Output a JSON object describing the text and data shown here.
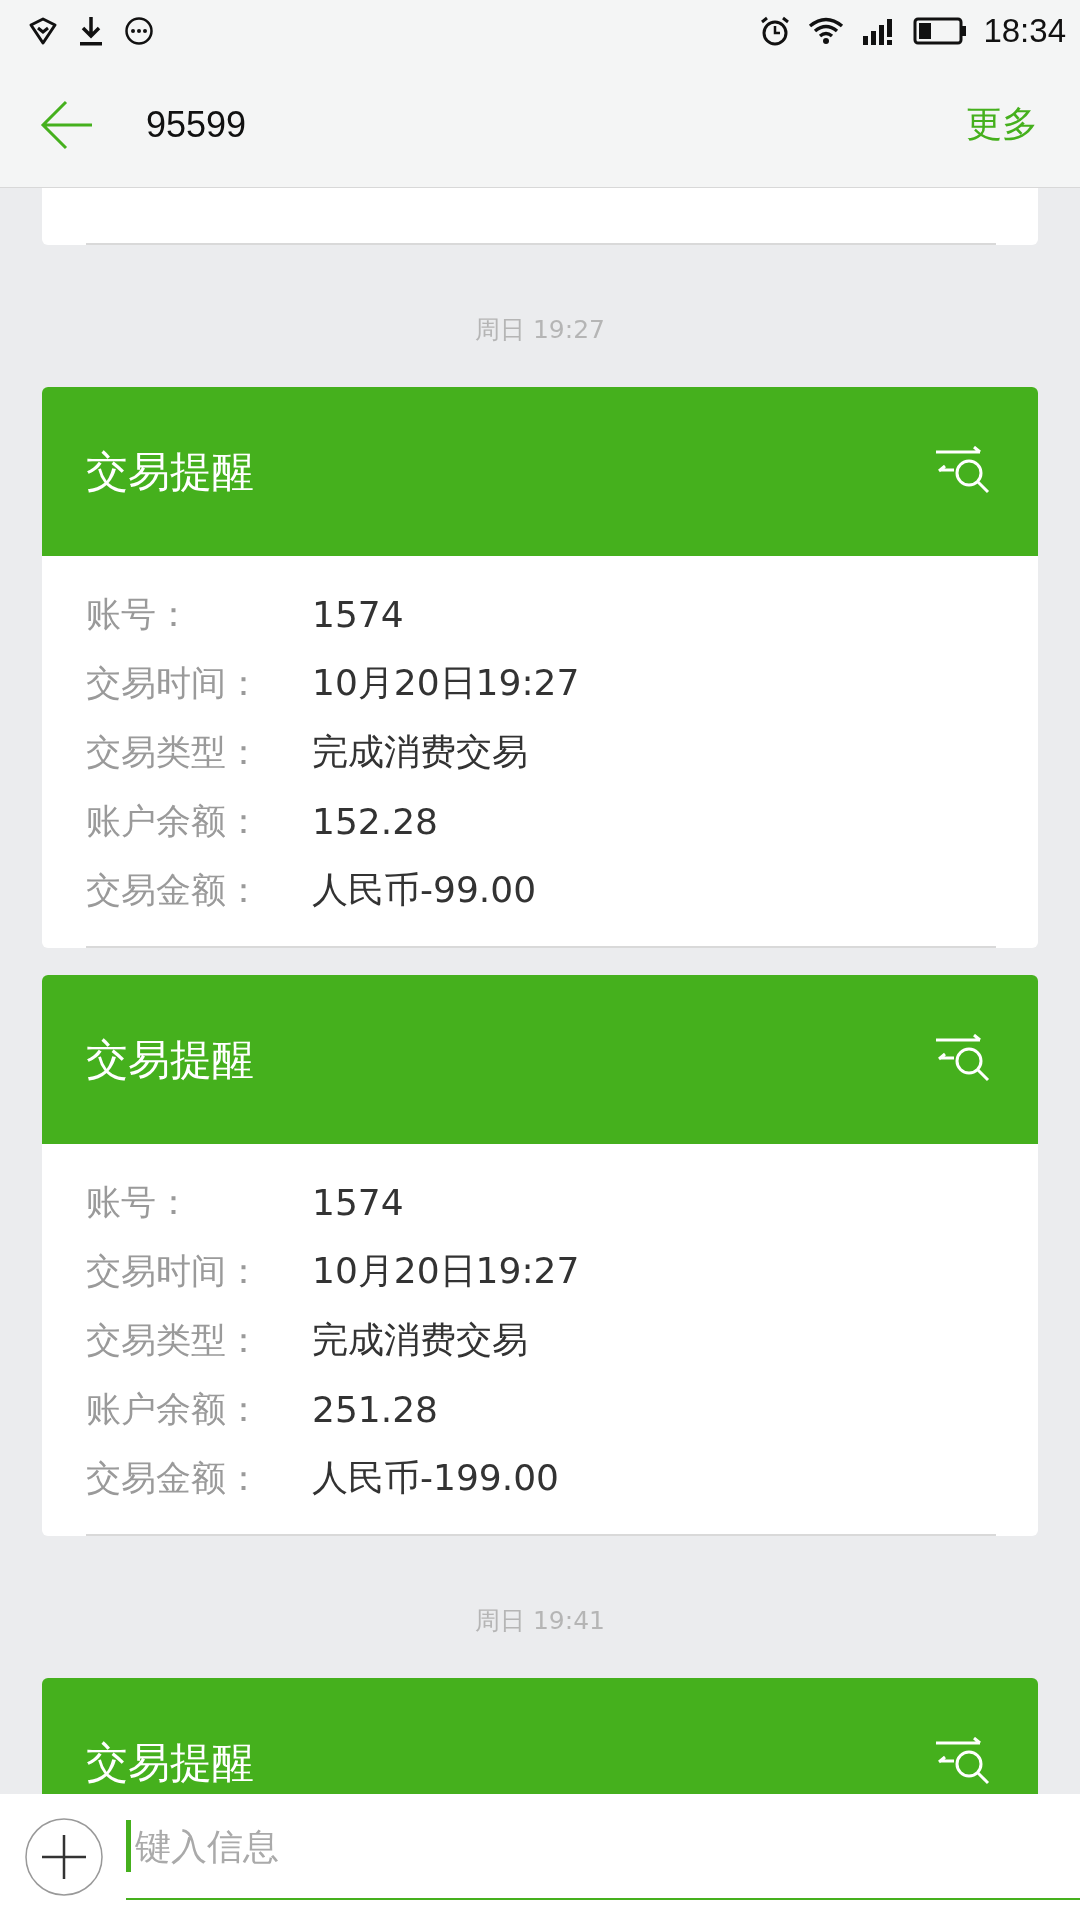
{
  "status_bar": {
    "time": "18:34"
  },
  "header": {
    "title": "95599",
    "action": "更多"
  },
  "messages": [
    {
      "kind": "card"
    },
    {
      "kind": "time",
      "text": "周日 19:27"
    },
    {
      "kind": "card",
      "title": "交易提醒",
      "rows": [
        {
          "label": "账号：",
          "value": "1574"
        },
        {
          "label": "交易时间：",
          "value": "10月20日19:27"
        },
        {
          "label": "交易类型：",
          "value": "完成消费交易"
        },
        {
          "label": "账户余额：",
          "value": "152.28"
        },
        {
          "label": "交易金额：",
          "value": "人民币-99.00"
        }
      ]
    },
    {
      "kind": "card",
      "title": "交易提醒",
      "rows": [
        {
          "label": "账号：",
          "value": "1574"
        },
        {
          "label": "交易时间：",
          "value": "10月20日19:27"
        },
        {
          "label": "交易类型：",
          "value": "完成消费交易"
        },
        {
          "label": "账户余额：",
          "value": "251.28"
        },
        {
          "label": "交易金额：",
          "value": "人民币-199.00"
        }
      ]
    },
    {
      "kind": "time",
      "text": "周日 19:41"
    },
    {
      "kind": "card",
      "title": "交易提醒"
    }
  ],
  "composer": {
    "placeholder": "键入信息"
  }
}
